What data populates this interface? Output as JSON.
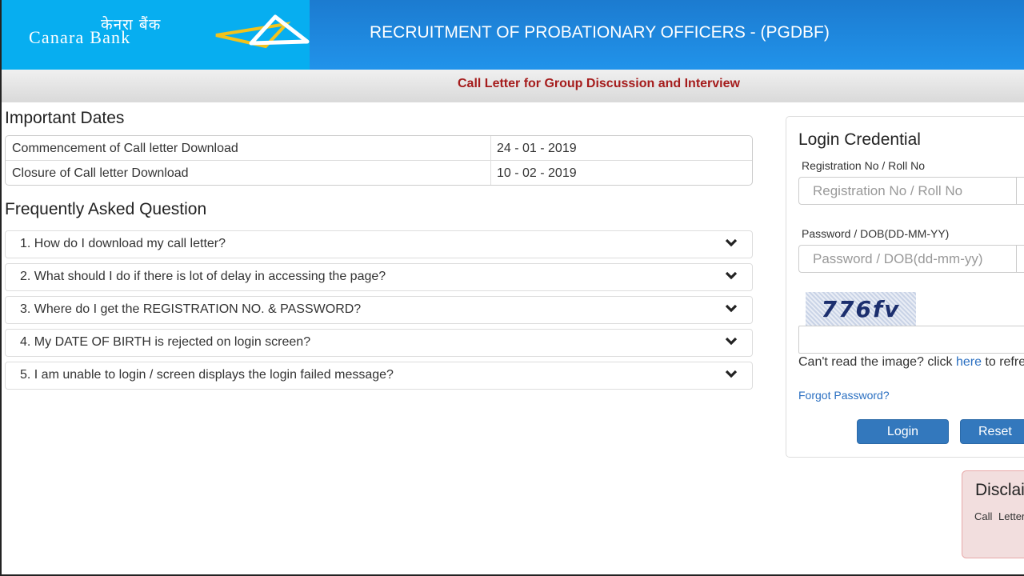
{
  "header": {
    "logo_hindi": "केनरा बैंक",
    "logo_english": "Canara Bank",
    "title": "RECRUITMENT OF PROBATIONARY OFFICERS - (PGDBF)",
    "subtitle": "Call Letter for Group Discussion and Interview",
    "colors": {
      "logo_bg": "#07aef0",
      "header_bg": "#2193ea",
      "subtitle": "#a51c1c"
    }
  },
  "important_dates": {
    "title": "Important Dates",
    "rows": [
      {
        "label": "Commencement of Call letter Download",
        "value": "24 - 01 - 2019"
      },
      {
        "label": "Closure of Call letter Download",
        "value": "10 - 02 - 2019"
      }
    ]
  },
  "faq": {
    "title": "Frequently Asked Question",
    "items": [
      {
        "question": "1. How do I download my call letter?",
        "icon": "chevron-down-icon"
      },
      {
        "question": "2. What should I do if there is lot of delay in accessing the page?",
        "icon": "chevron-down-icon"
      },
      {
        "question": "3. Where do I get the REGISTRATION NO. & PASSWORD?",
        "icon": "chevron-down-icon"
      },
      {
        "question": "4. My DATE OF BIRTH is rejected on login screen?",
        "icon": "chevron-down-icon"
      },
      {
        "question": "5. I am unable to login / screen displays the login failed message?",
        "icon": "chevron-down-icon"
      }
    ]
  },
  "login": {
    "title": "Login Credential",
    "registration_label": "Registration No / Roll No",
    "registration_placeholder": "Registration No / Roll No",
    "registration_value": "",
    "password_label": "Password / DOB(DD-MM-YY)",
    "password_placeholder": "Password / DOB(dd-mm-yy)",
    "password_value": "",
    "captcha_text": "776fv",
    "captcha_value": "",
    "cant_read_prefix": "Can't read the image? click ",
    "cant_read_link": "here",
    "cant_read_suffix": " to refresh.",
    "forgot_password": "Forgot Password?",
    "login_button": "Login",
    "reset_button": "Reset",
    "colors": {
      "button": "#3378bd",
      "link": "#2a6fc1"
    }
  },
  "disclaimer": {
    "title": "Disclaimer",
    "text": "Call Letter ... mentioned ... before th..."
  }
}
